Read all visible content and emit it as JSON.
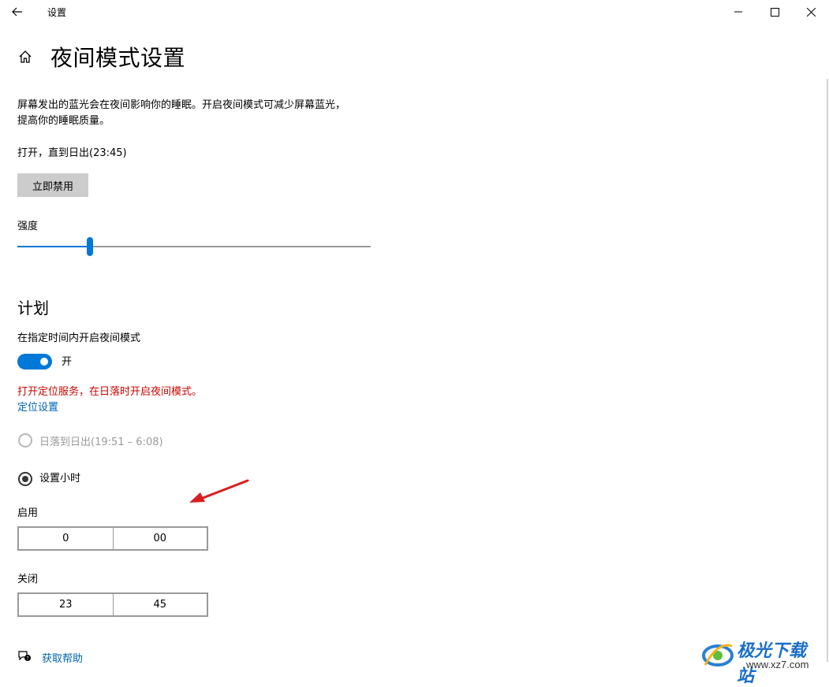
{
  "window": {
    "title": "设置"
  },
  "header": {
    "title": "夜间模式设置"
  },
  "description": {
    "line1": "屏幕发出的蓝光会在夜间影响你的睡眠。开启夜间模式可减少屏幕蓝光，",
    "line2": "提高你的睡眠质量。"
  },
  "status_text": "打开，直到日出(23:45)",
  "disable_button": "立即禁用",
  "strength": {
    "label": "强度",
    "value": 0.2
  },
  "schedule": {
    "title": "计划",
    "toggle_label": "在指定时间内开启夜间模式",
    "toggle_state": "开",
    "warning": "打开定位服务，在日落时开启夜间模式。",
    "location_link": "定位设置",
    "option_sunset": "日落到日出(19:51 – 6:08)",
    "option_hours": "设置小时"
  },
  "turn_on": {
    "label": "启用",
    "hour": "0",
    "minute": "00"
  },
  "turn_off": {
    "label": "关闭",
    "hour": "23",
    "minute": "45"
  },
  "help_link": "获取帮助",
  "watermark": {
    "name": "极光下载站",
    "url": "www.xz7.com"
  },
  "colors": {
    "accent": "#0078d7",
    "warning": "#c50500",
    "link": "#0063b1",
    "arrow": "#d81e1e"
  }
}
